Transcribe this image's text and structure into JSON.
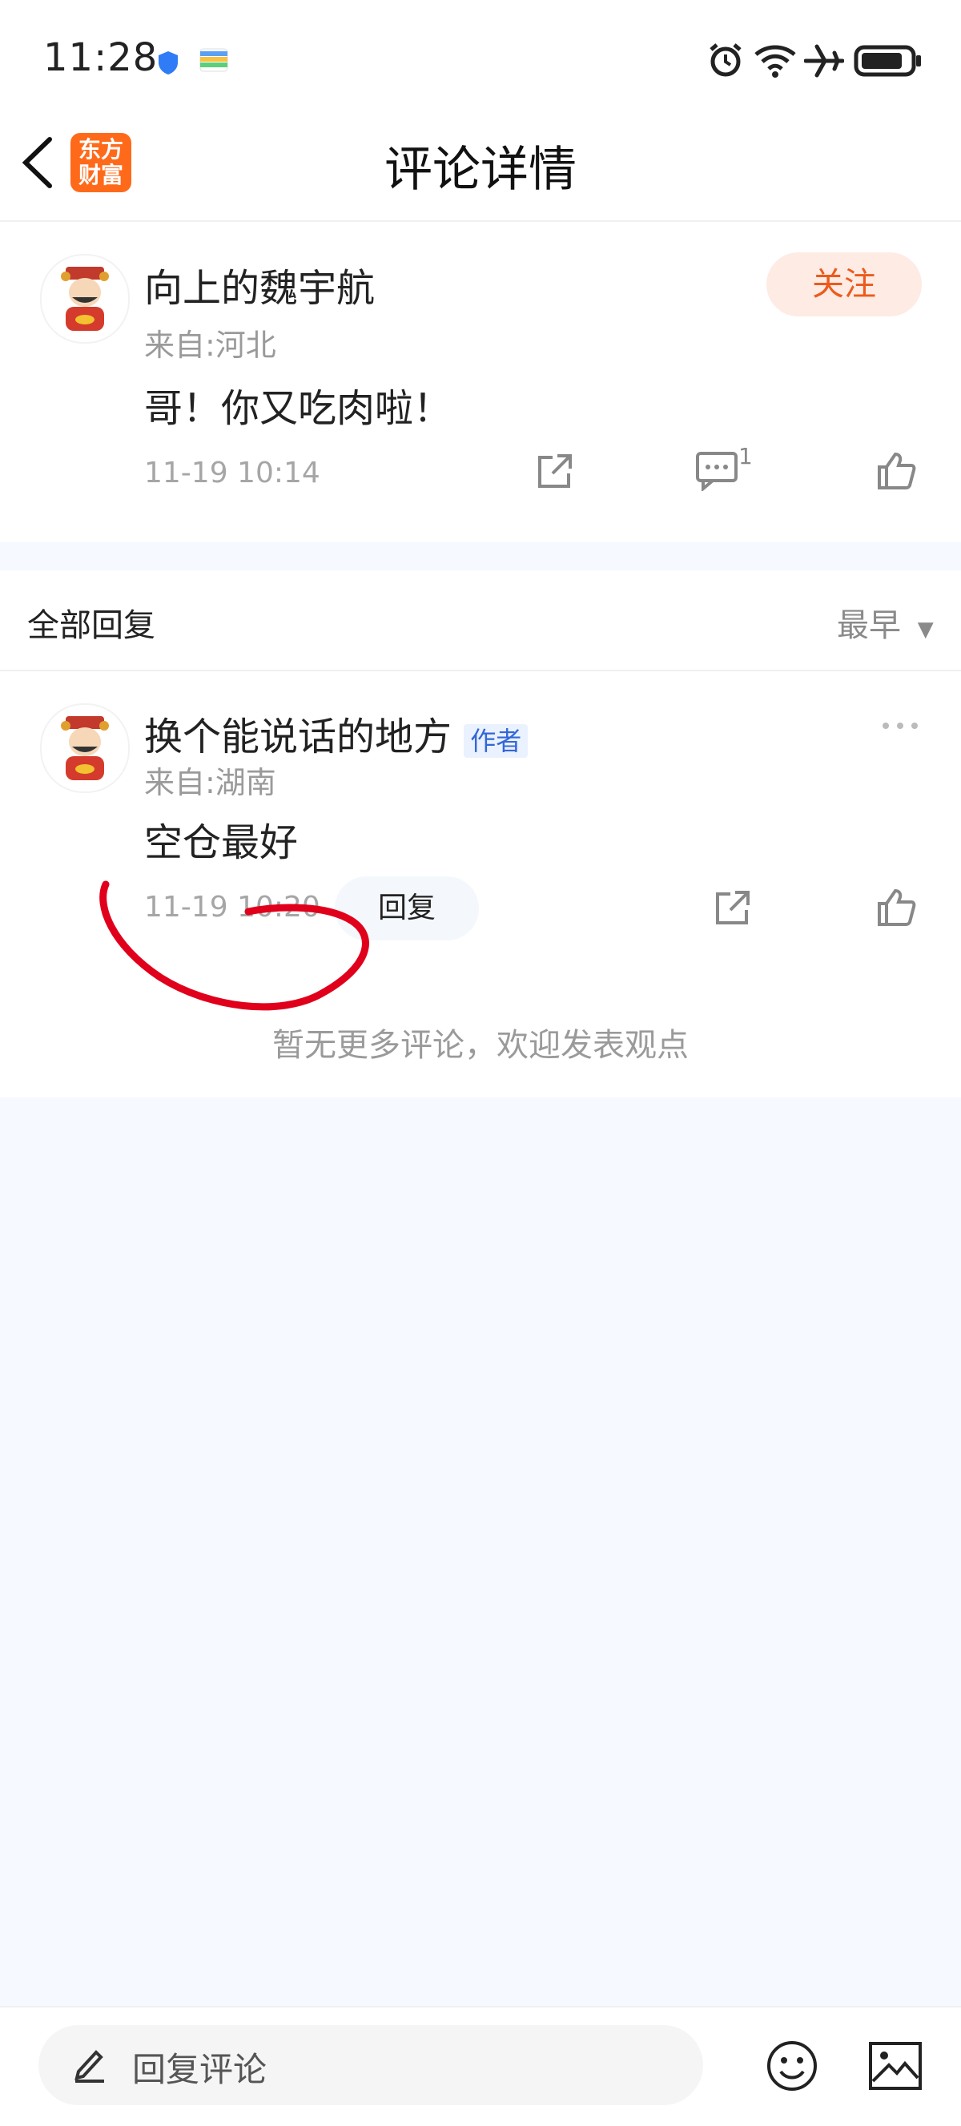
{
  "status": {
    "time": "11:28"
  },
  "header": {
    "title": "评论详情",
    "logo_text": "东方财富"
  },
  "comment": {
    "author": "向上的魏宇航",
    "location": "来自:河北",
    "text": "哥！你又吃肉啦！",
    "time": "11-19 10:14",
    "follow_label": "关注",
    "reply_count": "1"
  },
  "replies_section": {
    "title": "全部回复",
    "sort_label": "最早"
  },
  "reply": {
    "author": "换个能说话的地方",
    "tag": "作者",
    "location": "来自:湖南",
    "text": "空仓最好",
    "time": "11-19 10:20",
    "reply_label": "回复"
  },
  "footer_note": "暂无更多评论，欢迎发表观点",
  "bottom": {
    "placeholder": "回复评论"
  },
  "colors": {
    "accent": "#ec5b1c",
    "annotation": "#e0001b",
    "page_bg": "#f6f9ff"
  }
}
